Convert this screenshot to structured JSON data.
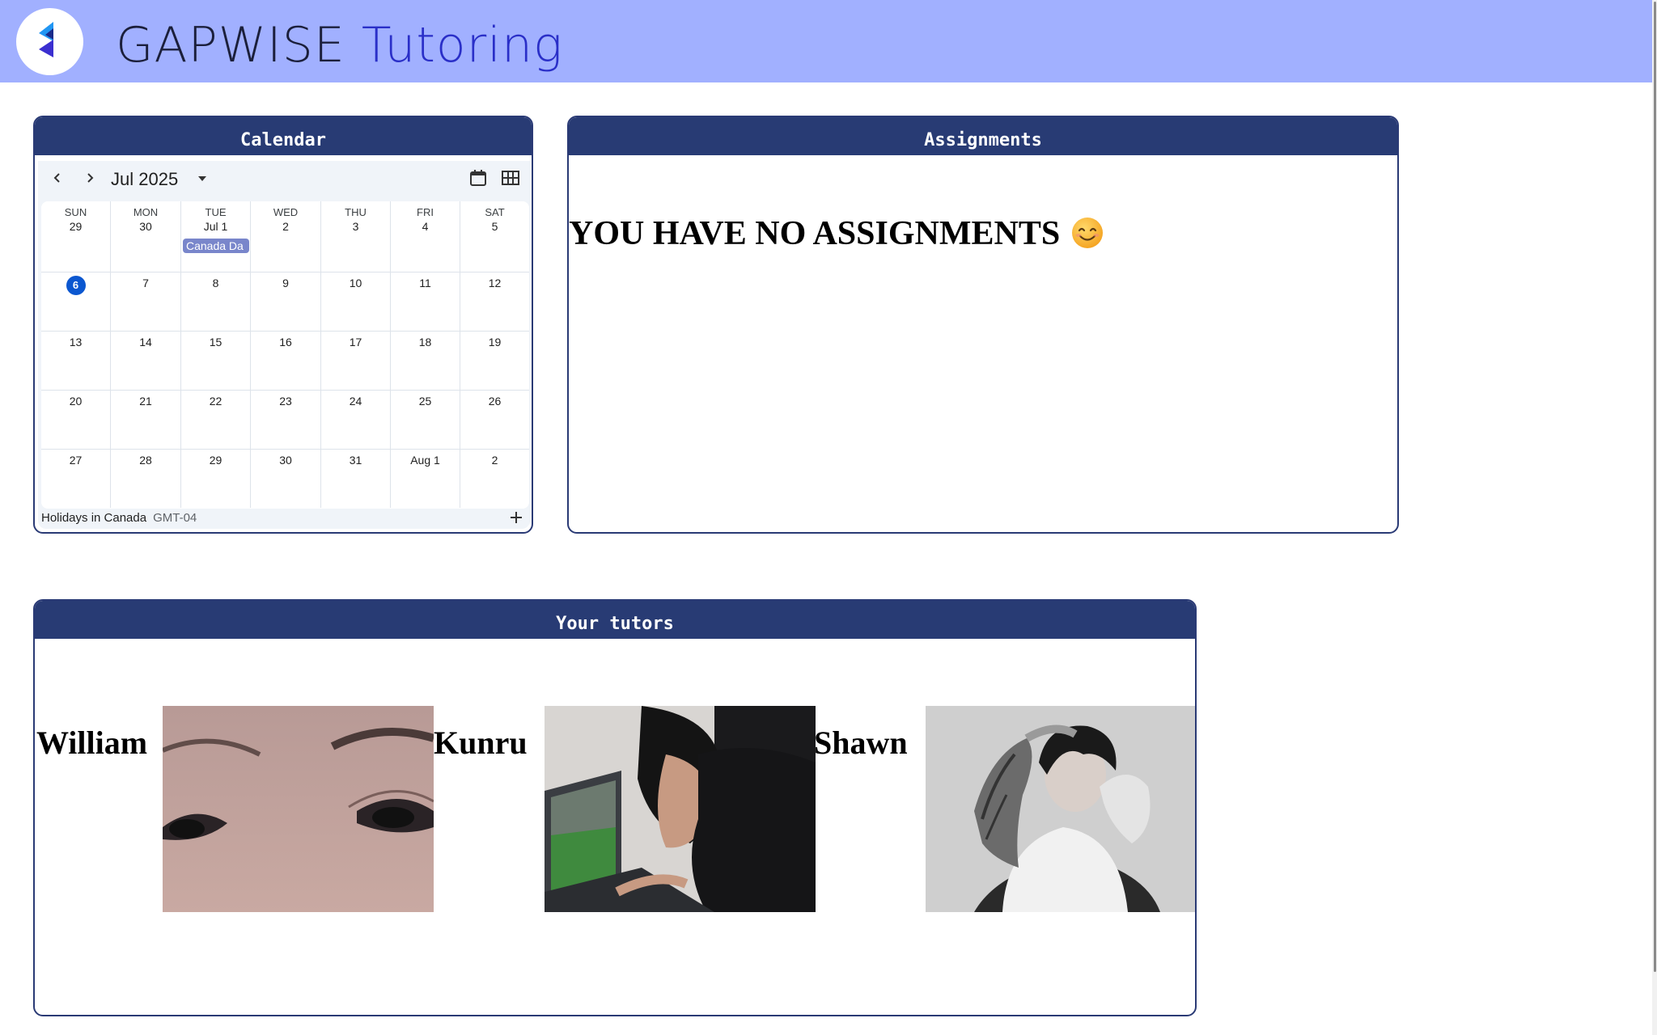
{
  "header": {
    "brand_word1": "GAPWISE",
    "brand_word2": "Tutoring",
    "colors": {
      "bar": "#a1b0ff",
      "word1": "#1b1f3b",
      "word2": "#2a2fc8"
    }
  },
  "calendar_panel": {
    "title": "Calendar",
    "month": "Jul 2025",
    "weekdays": [
      "SUN",
      "MON",
      "TUE",
      "WED",
      "THU",
      "FRI",
      "SAT"
    ],
    "first_row": [
      "29",
      "30",
      "Jul 1",
      "2",
      "3",
      "4",
      "5"
    ],
    "weeks": [
      [
        "6",
        "7",
        "8",
        "9",
        "10",
        "11",
        "12"
      ],
      [
        "13",
        "14",
        "15",
        "16",
        "17",
        "18",
        "19"
      ],
      [
        "20",
        "21",
        "22",
        "23",
        "24",
        "25",
        "26"
      ],
      [
        "27",
        "28",
        "29",
        "30",
        "31",
        "Aug 1",
        "2"
      ]
    ],
    "today": "6",
    "event": {
      "label": "Canada Da",
      "color": "#7986cb"
    },
    "footer": {
      "calendar_name": "Holidays in Canada",
      "timezone": "GMT-04"
    }
  },
  "assignments_panel": {
    "title": "Assignments",
    "message": "YOU HAVE NO ASSIGNMENTS"
  },
  "tutors_panel": {
    "title": "Your tutors",
    "tutors": [
      {
        "name": "William"
      },
      {
        "name": "Kunru"
      },
      {
        "name": "Shawn"
      }
    ]
  }
}
